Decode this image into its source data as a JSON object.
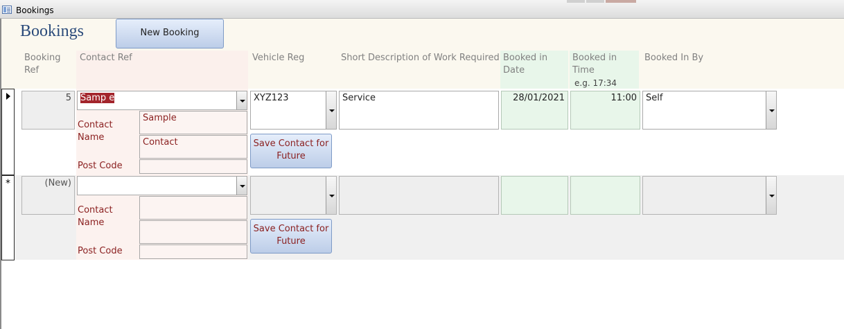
{
  "window": {
    "title": "Bookings"
  },
  "form": {
    "title": "Bookings",
    "new_booking_label": "New Booking"
  },
  "columns": {
    "booking_ref": "Booking Ref",
    "contact_ref": "Contact Ref",
    "vehicle_reg": "Vehicle Reg",
    "work_desc": "Short Description of Work Required",
    "booked_date": "Booked in Date",
    "booked_time": "Booked in Time",
    "time_hint": "e.g. 17:34",
    "booked_by": "Booked In By"
  },
  "labels": {
    "contact_name": "Contact Name",
    "post_code": "Post Code",
    "save_contact": "Save Contact for Future"
  },
  "records": [
    {
      "booking_ref": "5",
      "contact_ref": "Samp e",
      "contact_first": "Sample",
      "contact_last": "Contact",
      "post_code": "",
      "vehicle_reg": "XYZ123",
      "work_desc": "Service",
      "booked_date": "28/01/2021",
      "booked_time": "11:00",
      "booked_by": "Self"
    },
    {
      "booking_ref": "(New)",
      "contact_ref": "",
      "contact_first": "",
      "contact_last": "",
      "post_code": "",
      "vehicle_reg": "",
      "work_desc": "",
      "booked_date": "",
      "booked_time": "",
      "booked_by": ""
    }
  ],
  "record_selectors": {
    "current": "current-record-arrow",
    "new": "new-record-asterisk"
  }
}
